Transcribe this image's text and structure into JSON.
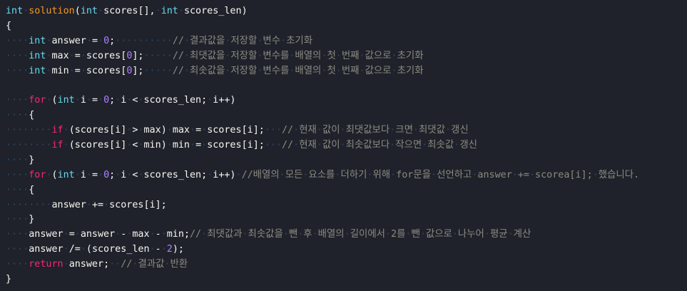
{
  "editor": {
    "colors": {
      "background": "#1f222b",
      "keyword": "#f92672",
      "type": "#66d9ef",
      "function": "#fd971f",
      "number": "#ae81ff",
      "comment": "#8b8b80",
      "text": "#f8f8f2",
      "whitespace": "#2c4763"
    },
    "lines": [
      "int solution(int scores[], int scores_len)",
      "{",
      "    int answer = 0;          // 결과값을 저장할 변수 초기화",
      "    int max = scores[0];     // 최댓값을 저장할 변수를 배열의 첫 번째 값으로 초기화",
      "    int min = scores[0];     // 최솟값을 저장할 변수를 배열의 첫 번째 값으로 초기화",
      "",
      "    for (int i = 0; i < scores_len; i++)",
      "    {",
      "        if (scores[i] > max) max = scores[i];   // 현재 값이 최댓값보다 크면 최댓값 갱신",
      "        if (scores[i] < min) min = scores[i];   // 현재 값이 최솟값보다 작으면 최솟값 갱신",
      "    }",
      "    for (int i = 0; i < scores_len; i++) //배열의 모든 요소를 더하기 위해 for문을 선언하고 answer += scorea[i]; 했습니다.",
      "    {",
      "        answer += scores[i];",
      "    }",
      "    answer = answer - max - min;// 최댓값과 최솟값을 뺀 후 배열의 길이에서 2를 뺀 값으로 나누어 평균 계산",
      "    answer /= (scores_len - 2);",
      "    return answer;  // 결과값 반환",
      "}"
    ]
  }
}
